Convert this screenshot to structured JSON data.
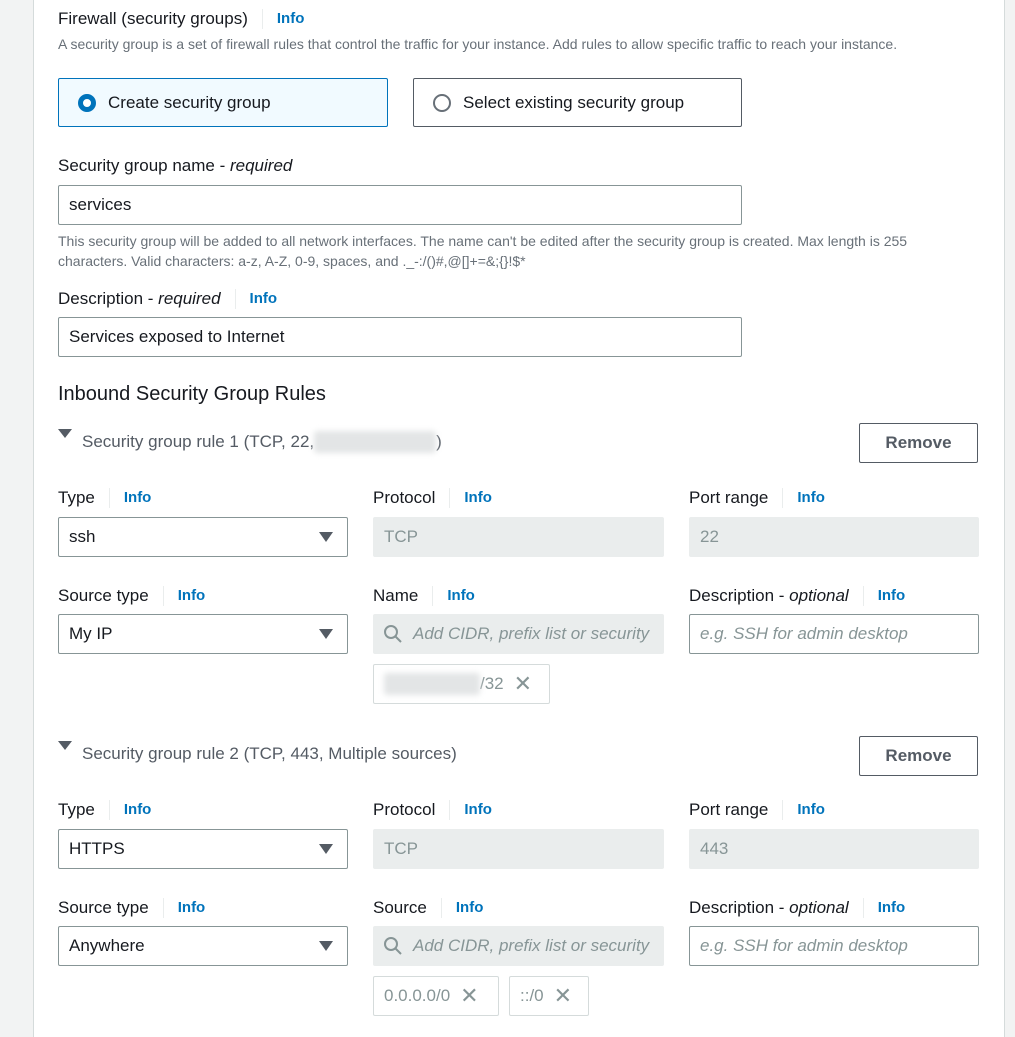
{
  "firewall": {
    "title": "Firewall (security groups)",
    "info": "Info",
    "description": "A security group is a set of firewall rules that control the traffic for your instance. Add rules to allow specific traffic to reach your instance.",
    "options": [
      {
        "label": "Create security group",
        "selected": true
      },
      {
        "label": "Select existing security group",
        "selected": false
      }
    ]
  },
  "sg_name": {
    "label": "Security group name - ",
    "label_suffix": "required",
    "value": "services",
    "hint": "This security group will be added to all network interfaces. The name can't be edited after the security group is created. Max length is 255 characters. Valid characters: a-z, A-Z, 0-9, spaces, and ._-:/()#,@[]+=&;{}!$*"
  },
  "sg_description": {
    "label": "Description - ",
    "label_suffix": "required",
    "info": "Info",
    "value": "Services exposed to Internet"
  },
  "inbound": {
    "title": "Inbound Security Group Rules",
    "rules": [
      {
        "title_prefix": "Security group rule 1 (TCP, 22, ",
        "title_redacted": true,
        "title_suffix": ")",
        "remove_label": "Remove",
        "type_label": "Type",
        "type_value": "ssh",
        "protocol_label": "Protocol",
        "protocol_value": "TCP",
        "port_label": "Port range",
        "port_value": "22",
        "source_type_label": "Source type",
        "source_type_value": "My IP",
        "source_label": "Name",
        "source_placeholder": "Add CIDR, prefix list or security",
        "source_tokens": [
          {
            "text": "/32",
            "redacted_prefix": true
          }
        ],
        "desc_label": "Description - ",
        "desc_label_suffix": "optional",
        "desc_placeholder": "e.g. SSH for admin desktop",
        "info": "Info"
      },
      {
        "title_prefix": "Security group rule 2 (TCP, 443, Multiple sources)",
        "title_redacted": false,
        "title_suffix": "",
        "remove_label": "Remove",
        "type_label": "Type",
        "type_value": "HTTPS",
        "protocol_label": "Protocol",
        "protocol_value": "TCP",
        "port_label": "Port range",
        "port_value": "443",
        "source_type_label": "Source type",
        "source_type_value": "Anywhere",
        "source_label": "Source",
        "source_placeholder": "Add CIDR, prefix list or security",
        "source_tokens": [
          {
            "text": "0.0.0.0/0",
            "redacted_prefix": false
          },
          {
            "text": "::/0",
            "redacted_prefix": false
          }
        ],
        "desc_label": "Description - ",
        "desc_label_suffix": "optional",
        "desc_placeholder": "e.g. SSH for admin desktop",
        "info": "Info"
      }
    ]
  },
  "icons": {
    "remove_token": "✕"
  }
}
